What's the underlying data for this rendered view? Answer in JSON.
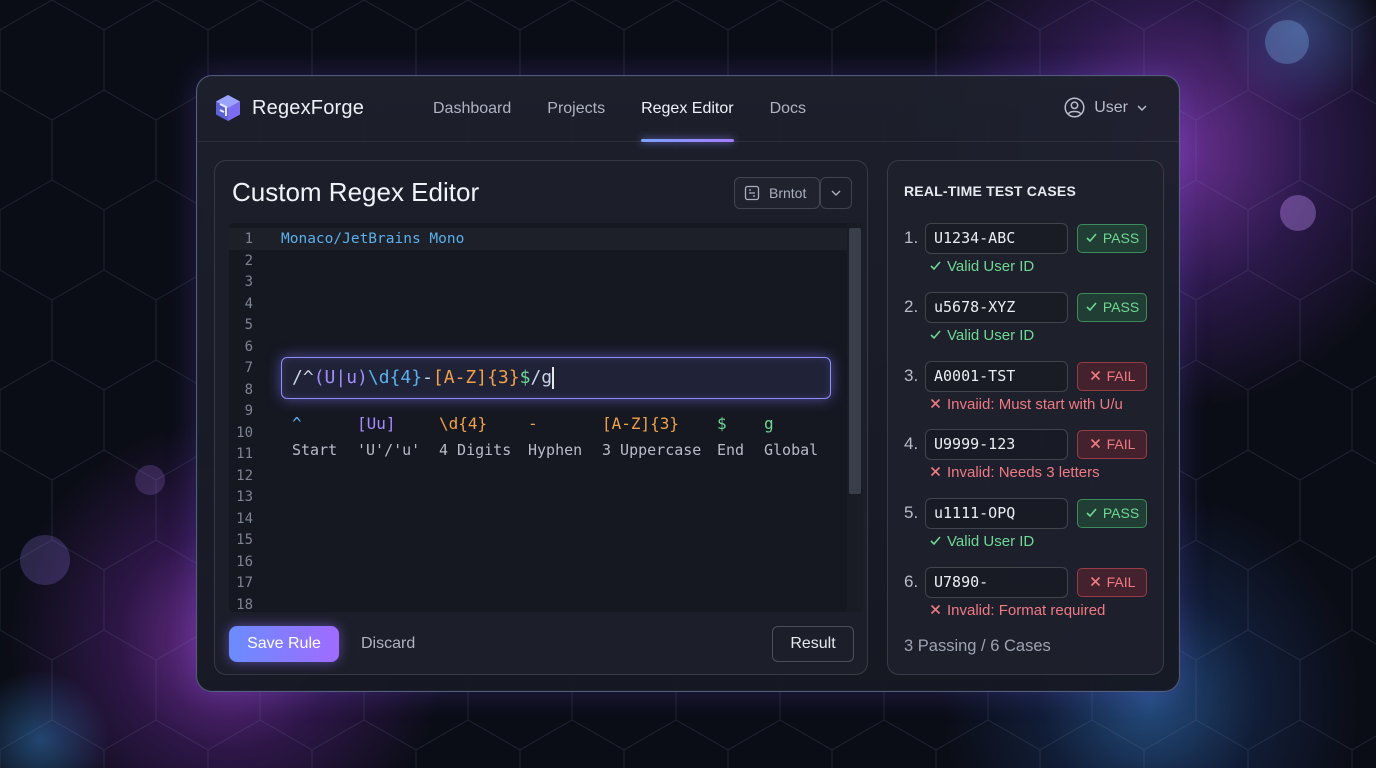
{
  "brand": {
    "name": "RegexForge"
  },
  "nav": {
    "items": [
      {
        "label": "Dashboard",
        "active": false
      },
      {
        "label": "Projects",
        "active": false
      },
      {
        "label": "Regex Editor",
        "active": true
      },
      {
        "label": "Docs",
        "active": false
      }
    ]
  },
  "user": {
    "label": "User",
    "icon": "user-circle-icon"
  },
  "editor": {
    "title": "Custom Regex Editor",
    "font_select_label": "Brntot",
    "font_hint": "Monaco/JetBrains Mono",
    "line_numbers": [
      "1",
      "2",
      "3",
      "4",
      "5",
      "6",
      "7",
      "8",
      "9",
      "10",
      "11",
      "12",
      "13",
      "14",
      "15",
      "16",
      "17",
      "18"
    ],
    "regex_parts": [
      {
        "text": "/^",
        "color": "#c9d3e6"
      },
      {
        "text": "(U|u)",
        "color": "#a48bff"
      },
      {
        "text": "\\d{4}",
        "color": "#5ab0ec"
      },
      {
        "text": "-",
        "color": "#c9d3e6"
      },
      {
        "text": "[A-Z]{3}",
        "color": "#f0a24a"
      },
      {
        "text": "$",
        "color": "#6fd894"
      },
      {
        "text": "/g",
        "color": "#c9d3e6"
      }
    ],
    "legend": [
      {
        "token": "^",
        "desc": "Start",
        "color": "#5ab0ec"
      },
      {
        "token": "[Uu]",
        "desc": "'U'/'u'",
        "color": "#a48bff"
      },
      {
        "token": "\\d{4}",
        "desc": "4 Digits",
        "color": "#f0a24a"
      },
      {
        "token": "-",
        "desc": "Hyphen",
        "color": "#f0a24a"
      },
      {
        "token": "[A-Z]{3}",
        "desc": "3 Uppercase",
        "color": "#f0a24a"
      },
      {
        "token": "$",
        "desc": "End",
        "color": "#6fd894"
      },
      {
        "token": "g",
        "desc": "Global",
        "color": "#6fd894"
      }
    ],
    "save_label": "Save Rule",
    "discard_label": "Discard",
    "result_label": "Result"
  },
  "tests": {
    "title": "REAL-TIME TEST CASES",
    "cases": [
      {
        "num": "1.",
        "value": "U1234-ABC",
        "status": "PASS",
        "note": "Valid User ID"
      },
      {
        "num": "2.",
        "value": "u5678-XYZ",
        "status": "PASS",
        "note": "Valid User ID"
      },
      {
        "num": "3.",
        "value": "A0001-TST",
        "status": "FAIL",
        "note": "Invaiid: Must start with U/u"
      },
      {
        "num": "4.",
        "value": "U9999-123",
        "status": "FAIL",
        "note": "Invalid: Needs 3 letters"
      },
      {
        "num": "5.",
        "value": "u1111-OPQ",
        "status": "PASS",
        "note": "Valid User ID"
      },
      {
        "num": "6.",
        "value": "U7890-",
        "status": "FAIL",
        "note": "Invalid: Format required"
      }
    ],
    "summary": "3 Passing / 6 Cases"
  },
  "colors": {
    "accent": "#8d8cff",
    "pass": "#6fd894",
    "fail": "#f07a84"
  }
}
